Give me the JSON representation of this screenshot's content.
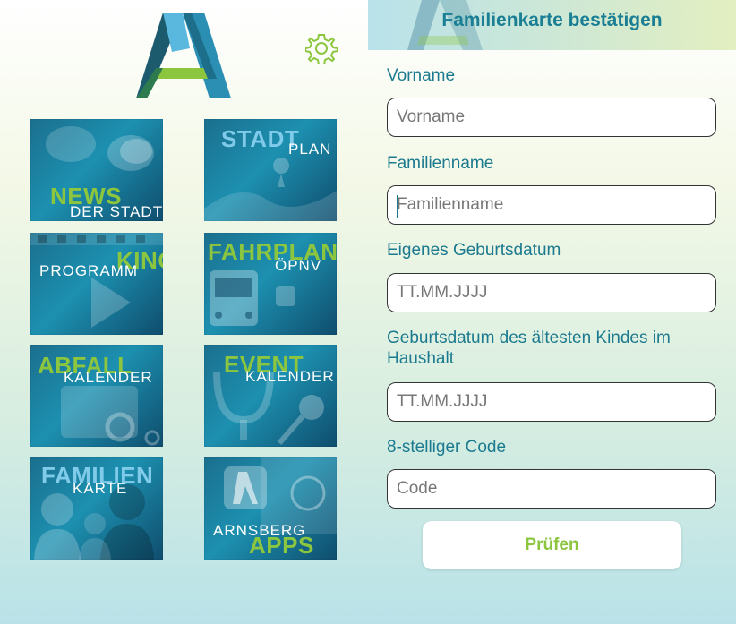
{
  "colors": {
    "accent_green": "#8cc63f",
    "accent_blue": "#7fcbe9",
    "teal_text": "#1b7a8f"
  },
  "icons": {
    "logo": "arnsberg-a-logo",
    "settings": "gear-icon"
  },
  "tiles": {
    "news": {
      "big": "NEWS",
      "small": "DER STADT"
    },
    "stadtplan": {
      "big": "STADT",
      "small": "PLAN"
    },
    "kino": {
      "big": "KINO",
      "small": "PROGRAMM"
    },
    "fahrplan": {
      "big": "FAHRPLAN",
      "small": "ÖPNV"
    },
    "abfall": {
      "big": "ABFALL",
      "small": "KALENDER"
    },
    "event": {
      "big": "EVENT",
      "small": "KALENDER"
    },
    "familien": {
      "big": "FAMILIEN",
      "small": "KARTE"
    },
    "apps": {
      "small": "ARNSBERG",
      "big": "APPS"
    }
  },
  "form": {
    "title": "Familienkarte bestätigen",
    "vorname_label": "Vorname",
    "vorname_placeholder": "Vorname",
    "familienname_label": "Familienname",
    "familienname_placeholder": "Familienname",
    "geburtsdatum_label": "Eigenes Geburtsdatum",
    "geburtsdatum_placeholder": "TT.MM.JJJJ",
    "kind_label": "Geburtsdatum des ältesten Kindes im Haushalt",
    "kind_placeholder": "TT.MM.JJJJ",
    "code_label": "8-stelliger Code",
    "code_placeholder": "Code",
    "submit_label": "Prüfen"
  }
}
